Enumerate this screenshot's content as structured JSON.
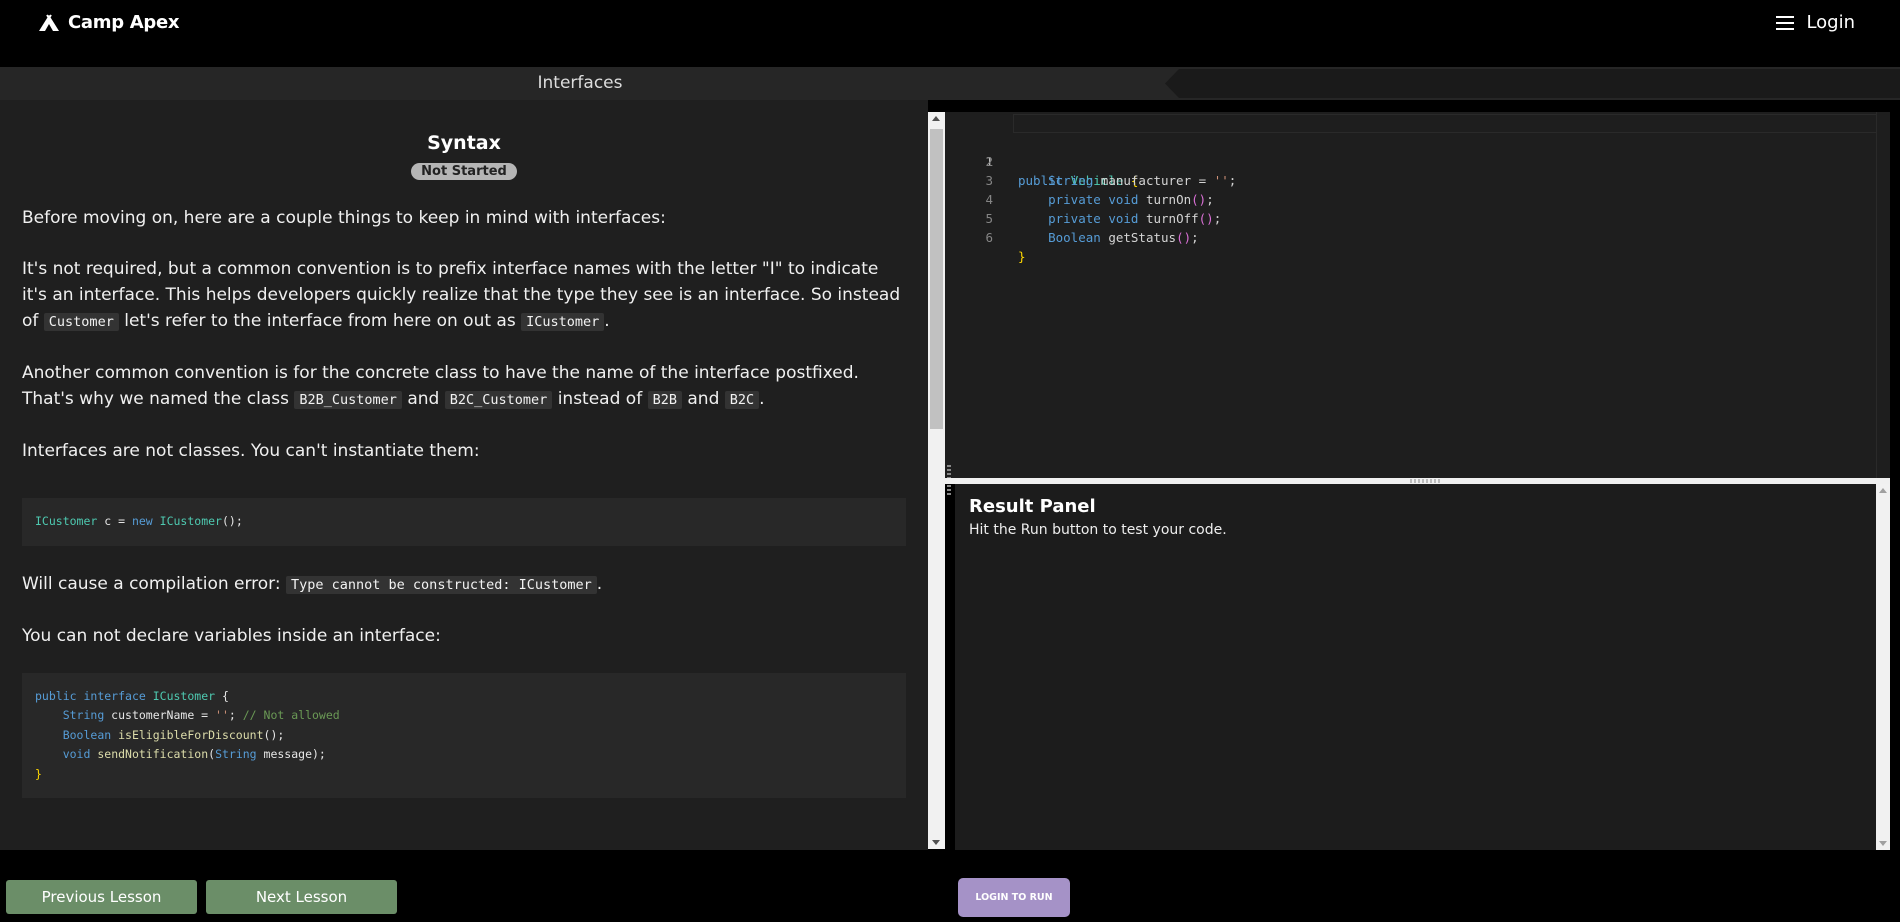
{
  "header": {
    "brand": "Camp Apex",
    "login_label": "Login"
  },
  "lesson_bar": {
    "title": "Interfaces"
  },
  "lesson": {
    "heading": "Syntax",
    "status": "Not Started",
    "p1": "Before moving on, here are a couple things to keep in mind with interfaces:",
    "p2a": "It's not required, but a common convention is to prefix interface names with the letter \"I\" to indicate it's an interface. This helps developers quickly realize that the type they see is an interface. So instead of ",
    "p2_code1": "Customer",
    "p2b": " let's refer to the interface from here on out as ",
    "p2_code2": "ICustomer",
    "p2c": ".",
    "p3a": "Another common convention is for the concrete class to have the name of the interface postfixed. That's why we named the class ",
    "p3_code1": "B2B_Customer",
    "p3b": " and ",
    "p3_code2": "B2C_Customer",
    "p3c": " instead of ",
    "p3_code3": "B2B",
    "p3d": " and ",
    "p3_code4": "B2C",
    "p3e": ".",
    "p4": "Interfaces are not classes. You can't instantiate them:",
    "code1": {
      "t1": "ICustomer",
      "t2": " c = ",
      "t3": "new",
      "t4": " ",
      "t5": "ICustomer",
      "t6": "();"
    },
    "p5a": "Will cause a compilation error: ",
    "p5_code": "Type cannot be constructed: ICustomer",
    "p5b": ".",
    "p6": "You can not declare variables inside an interface:",
    "code2": {
      "l1_kw1": "public",
      "l1_kw2": "interface",
      "l1_ty": "ICustomer",
      "l1_rest": " {",
      "l2_ty": "String",
      "l2_name": " customerName = ",
      "l2_str": "''",
      "l2_semi": "; ",
      "l2_cm": "// Not allowed",
      "l3_ty": "Boolean",
      "l3_fn": "isEligibleForDiscount",
      "l3_rest": "();",
      "l4_kw": "void",
      "l4_fn": "sendNotification",
      "l4_p1": "(",
      "l4_ty": "String",
      "l4_rest": " message);",
      "l5": "}"
    }
  },
  "editor": {
    "line_numbers": [
      "1",
      "2",
      "3",
      "4",
      "5",
      "6"
    ],
    "l1": {
      "kw": "public",
      "ty": "Vehicle",
      "br": "{"
    },
    "l2": {
      "ty": "String",
      "name": " manufacturer = ",
      "str": "''",
      "semi": ";"
    },
    "l3": {
      "kw1": "private",
      "kw2": "void",
      "fn": "turnOn",
      "paren": "()",
      "semi": ";"
    },
    "l4": {
      "kw1": "private",
      "kw2": "void",
      "fn": "turnOff",
      "paren": "()",
      "semi": ";"
    },
    "l5": {
      "ty": "Boolean",
      "fn": "getStatus",
      "paren": "()",
      "semi": ";"
    },
    "l6": {
      "br": "}"
    }
  },
  "result_panel": {
    "title": "Result Panel",
    "message": "Hit the Run button to test your code."
  },
  "footer": {
    "previous_label": "Previous Lesson",
    "next_label": "Next Lesson",
    "run_label": "LOGIN TO RUN"
  },
  "colors": {
    "nav_button": "#6b8e68",
    "run_button": "#a592c7",
    "background": "#000000",
    "panel": "#1f1f1f"
  }
}
